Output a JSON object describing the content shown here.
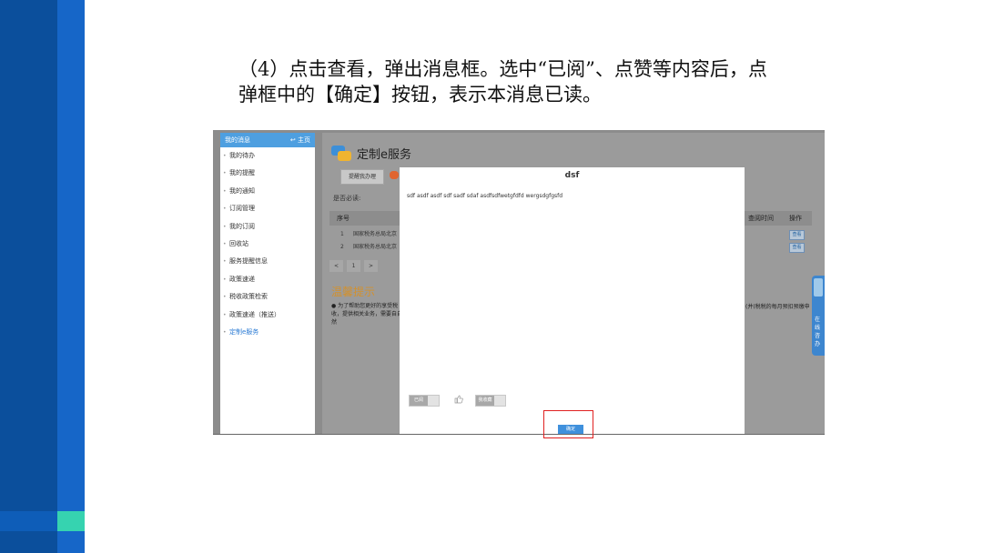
{
  "instruction": {
    "line1": "（4）点击查看，弹出消息框。选中“已阅”、点赞等内容后，点",
    "line2": "弹框中的【确定】按钮，表示本消息已读。"
  },
  "sidebar": {
    "header": "我的消息",
    "home": "主页",
    "items": [
      {
        "label": "我的待办"
      },
      {
        "label": "我的提醒"
      },
      {
        "label": "我的通知"
      },
      {
        "label": "订阅管理"
      },
      {
        "label": "我的订阅"
      },
      {
        "label": "回收站"
      },
      {
        "label": "服务提醒信息"
      },
      {
        "label": "政策速递"
      },
      {
        "label": "税收政策检索"
      },
      {
        "label": "政策速递（推送）"
      },
      {
        "label": "定制e服务"
      }
    ]
  },
  "main": {
    "title": "定制e服务",
    "tab": "提醒我办理",
    "filter_label": "是否必读:",
    "columns": {
      "index": "序号",
      "view_time": "查阅时间",
      "action": "操作"
    },
    "rows": [
      {
        "index": "1",
        "text": "国家税务总局北京",
        "action": "查看"
      },
      {
        "index": "2",
        "text": "国家税务总局北京",
        "action": "查看"
      }
    ],
    "pager": {
      "prev": "<",
      "page": "1",
      "next": ">"
    },
    "warm_title": "温馨提示",
    "warm_text": "● 为了帮助您更好的享受税收，提供相关业务，需要自自然",
    "warm_right": "(并(税税的每月预扣预缴申"
  },
  "float_tab": {
    "text": "在线咨办"
  },
  "modal": {
    "title": "dsf",
    "content": "sdf asdf asdf sdf sadf sdaf asdfsdfwetgfdfd wergsdgfgsfd",
    "toggle1": "已阅",
    "toggle2": "我收藏",
    "ok": "确定"
  },
  "colors": {
    "band_dark": "#0b4f9c",
    "band_light": "#1666c8",
    "band_teal": "#36d3b0",
    "accent_blue": "#3f90dc",
    "highlight_red": "#e02020"
  }
}
